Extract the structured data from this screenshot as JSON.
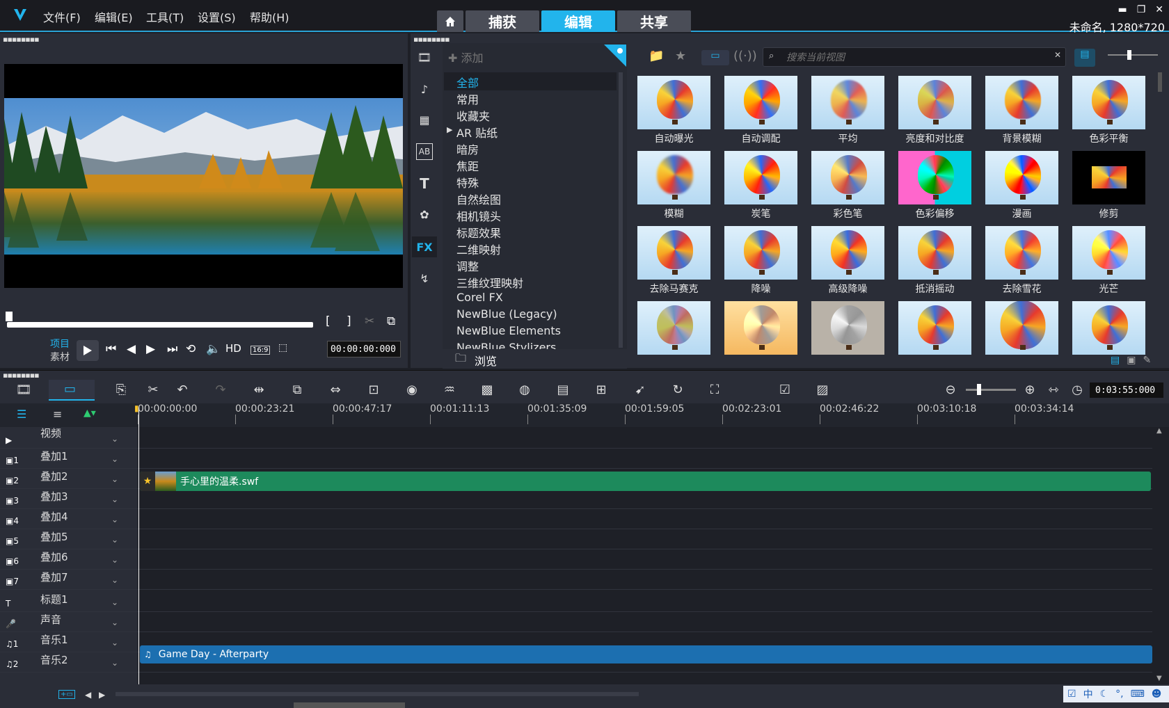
{
  "app": {
    "menus": [
      "文件(F)",
      "编辑(E)",
      "工具(T)",
      "设置(S)",
      "帮助(H)"
    ],
    "tabs": [
      "捕获",
      "编辑",
      "共享"
    ],
    "active_tab": "编辑",
    "project_info": "未命名, 1280*720",
    "accent_color": "#22b4ec"
  },
  "preview": {
    "mode_project": "项目",
    "mode_clip": "素材",
    "hd_label": "HD",
    "aspect_label": "16:9",
    "timecode": "00:00:00:000"
  },
  "library": {
    "add_label": "添加",
    "browse_label": "浏览",
    "search_placeholder": "搜索当前视图",
    "fx_label": "FX",
    "categories": [
      "全部",
      "常用",
      "收藏夹",
      "AR 贴纸",
      "暗房",
      "焦距",
      "特殊",
      "自然绘图",
      "相机镜头",
      "标题效果",
      "二维映射",
      "调整",
      "三维纹理映射",
      "Corel FX",
      "NewBlue (Legacy)",
      "NewBlue Elements",
      "NewBlue Stylizers"
    ],
    "selected_category": "全部",
    "filters": [
      "自动曝光",
      "自动调配",
      "平均",
      "亮度和对比度",
      "背景模糊",
      "色彩平衡",
      "模糊",
      "炭笔",
      "彩色笔",
      "色彩偏移",
      "漫画",
      "修剪",
      "去除马赛克",
      "降噪",
      "高级降噪",
      "抵消摇动",
      "去除雪花",
      "光芒",
      "",
      "",
      "",
      "",
      "",
      ""
    ]
  },
  "timeline": {
    "total_time": "0:03:55:000",
    "ruler": [
      "00:00:00:00",
      "00:00:23:21",
      "00:00:47:17",
      "00:01:11:13",
      "00:01:35:09",
      "00:01:59:05",
      "00:02:23:01",
      "00:02:46:22",
      "00:03:10:18",
      "00:03:34:14"
    ],
    "tracks": [
      "视频",
      "叠加1",
      "叠加2",
      "叠加3",
      "叠加4",
      "叠加5",
      "叠加6",
      "叠加7",
      "标题1",
      "声音",
      "音乐1",
      "音乐2"
    ],
    "video_clip": "手心里的温柔.swf",
    "audio_clip": "Game Day - Afterparty"
  },
  "ime": {
    "lang": "中"
  }
}
